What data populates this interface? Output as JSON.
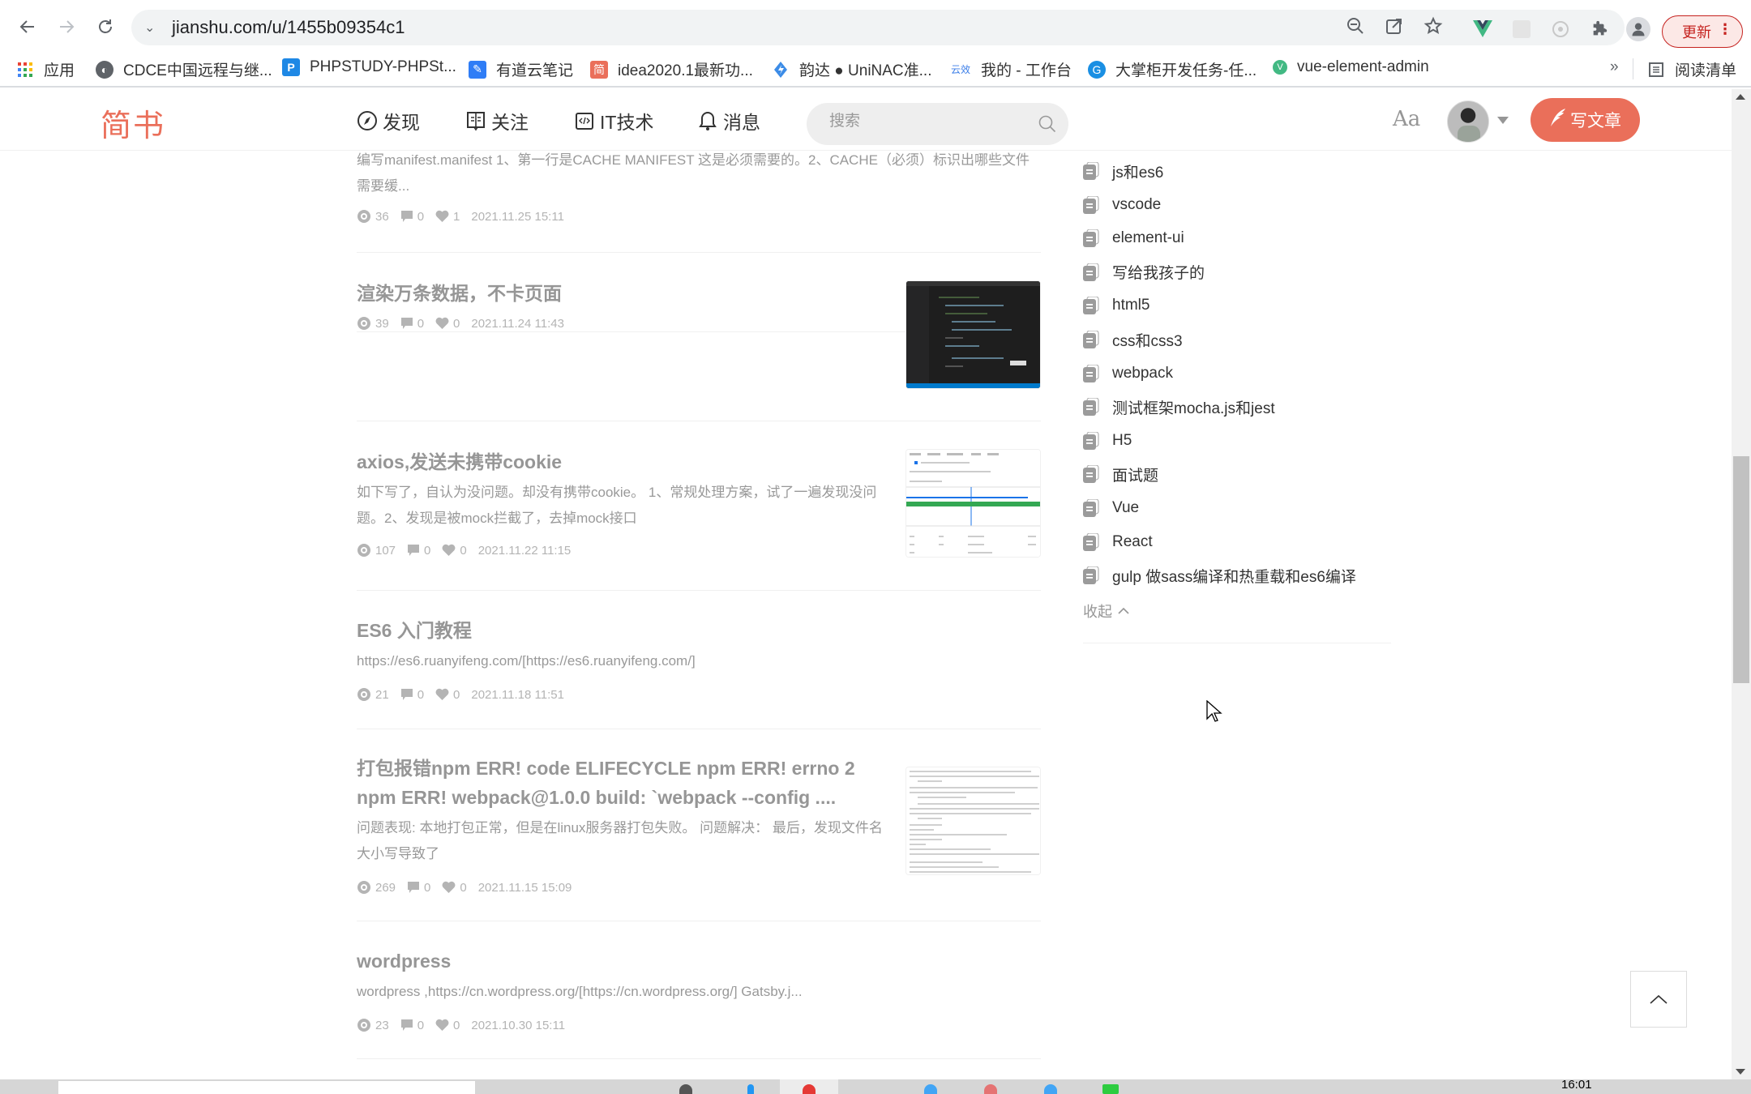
{
  "browser": {
    "url": "jianshu.com/u/1455b09354c1",
    "update_label": "更新",
    "bookmarks": [
      {
        "label": "应用",
        "icon": "apps-grid-icon"
      },
      {
        "label": "CDCE中国远程与继...",
        "icon": "globe-icon"
      },
      {
        "label": "PHPSTUDY-PHPSt...",
        "icon": "phpstudy-icon"
      },
      {
        "label": "有道云笔记",
        "icon": "youdao-note-icon"
      },
      {
        "label": "idea2020.1最新功...",
        "icon": "jianshu-icon"
      },
      {
        "label": "韵达 ● UniNAC准...",
        "icon": "yunda-icon"
      },
      {
        "label": "我的 - 工作台",
        "icon": "yunxiao-icon"
      },
      {
        "label": "大掌柜开发任务-任...",
        "icon": "dazhanggui-icon"
      },
      {
        "label": "vue-element-admin",
        "icon": "vue-icon"
      }
    ],
    "more_bookmarks": "»",
    "reading_list_label": "阅读清单"
  },
  "site": {
    "logo": "简书",
    "nav": [
      {
        "label": "发现",
        "icon": "compass-icon"
      },
      {
        "label": "关注",
        "icon": "book-icon"
      },
      {
        "label": "IT技术",
        "icon": "code-icon"
      },
      {
        "label": "消息",
        "icon": "bell-icon"
      }
    ],
    "search_placeholder": "搜索",
    "font_toggle": "Aa",
    "write_label": "写文章",
    "accent_color": "#ea6f5a"
  },
  "articles": [
    {
      "title": "",
      "abstract": "编写manifest.manifest 1、第一行是CACHE MANIFEST 这是必须需要的。2、CACHE（必须）标识出哪些文件需要缓...",
      "views": "36",
      "comments": "0",
      "likes": "1",
      "date": "2021.11.25 15:11",
      "thumb": null
    },
    {
      "title": "渲染万条数据，不卡页面",
      "abstract": "",
      "views": "39",
      "comments": "0",
      "likes": "0",
      "date": "2021.11.24 11:43",
      "thumb": "code-editor-screenshot"
    },
    {
      "title": "axios,发送未携带cookie",
      "abstract": "如下写了，自认为没问题。却没有携带cookie。 1、常规处理方案，试了一遍发现没问题。2、发现是被mock拦截了，去掉mock接口",
      "views": "107",
      "comments": "0",
      "likes": "0",
      "date": "2021.11.22 11:15",
      "thumb": "devtools-network-screenshot"
    },
    {
      "title": "ES6 入门教程",
      "abstract": "https://es6.ruanyifeng.com/[https://es6.ruanyifeng.com/]",
      "views": "21",
      "comments": "0",
      "likes": "0",
      "date": "2021.11.18 11:51",
      "thumb": null
    },
    {
      "title": "打包报错npm ERR! code ELIFECYCLE npm ERR! errno 2 npm ERR! webpack@1.0.0 build: `webpack --config ....",
      "abstract": "问题表现: 本地打包正常，但是在linux服务器打包失败。 问题解决： 最后，发现文件名大小写导致了",
      "views": "269",
      "comments": "0",
      "likes": "0",
      "date": "2021.11.15 15:09",
      "thumb": "terminal-log-screenshot"
    },
    {
      "title": "wordpress",
      "abstract": "wordpress ,https://cn.wordpress.org/[https://cn.wordpress.org/] Gatsby.j...",
      "views": "23",
      "comments": "0",
      "likes": "0",
      "date": "2021.10.30 15:11",
      "thumb": null
    }
  ],
  "notebooks": {
    "items": [
      "js和es6",
      "vscode",
      "element-ui",
      "写给我孩子的",
      "html5",
      "css和css3",
      "webpack",
      "测试框架mocha.js和jest",
      "H5",
      "面试题",
      "Vue",
      "React",
      "gulp 做sass编译和热重载和es6编译"
    ],
    "collapse_label": "收起"
  },
  "page_scroll": {
    "position_fraction": 0.48
  },
  "taskbar": {
    "clock": "16:01"
  }
}
